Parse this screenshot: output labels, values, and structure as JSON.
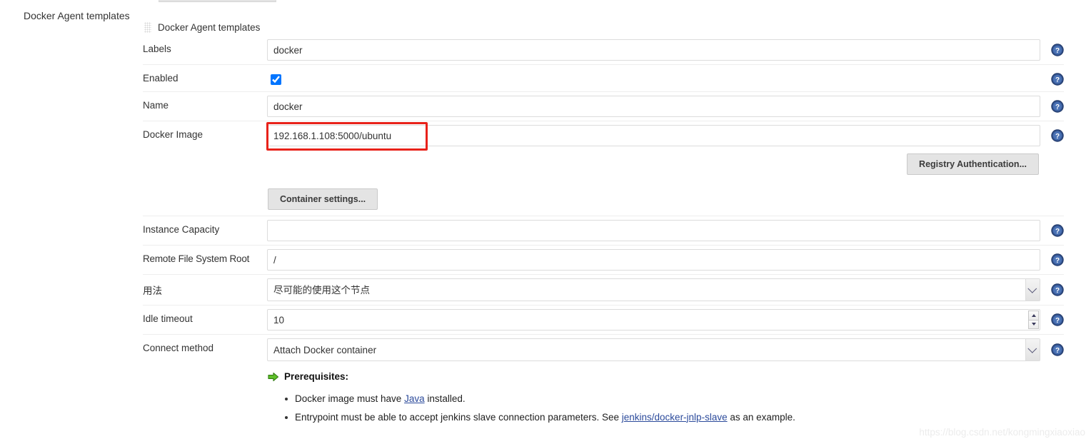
{
  "outer": {
    "section_label": "Docker Agent templates"
  },
  "template": {
    "header_title": "Docker Agent templates",
    "drag_handle_icon": "drag-grip-icon"
  },
  "fields": {
    "labels": {
      "label": "Labels",
      "value": "docker",
      "placeholder": ""
    },
    "enabled": {
      "label": "Enabled",
      "checked": true
    },
    "name": {
      "label": "Name",
      "value": "docker",
      "placeholder": ""
    },
    "docker_image": {
      "label": "Docker Image",
      "value": "192.168.1.108:5000/ubuntu",
      "placeholder": "",
      "highlight_color": "#e8221a"
    },
    "instance_capacity": {
      "label": "Instance Capacity",
      "value": "",
      "placeholder": ""
    },
    "remote_fs_root": {
      "label": "Remote File System Root",
      "value": "/",
      "placeholder": ""
    },
    "usage": {
      "label": "用法",
      "value": "尽可能的使用这个节点",
      "options": [
        "尽可能的使用这个节点"
      ]
    },
    "idle_timeout": {
      "label": "Idle timeout",
      "value": "10",
      "placeholder": ""
    },
    "connect_method": {
      "label": "Connect method",
      "value": "Attach Docker container",
      "options": [
        "Attach Docker container"
      ]
    }
  },
  "buttons": {
    "registry_authentication": "Registry Authentication...",
    "container_settings": "Container settings..."
  },
  "prerequisites": {
    "heading": "Prerequisites:",
    "arrow_icon": "green-arrow-icon",
    "items": [
      {
        "before": "Docker image must have ",
        "link": "Java",
        "after": " installed."
      },
      {
        "before": "Entrypoint must be able to accept jenkins slave connection parameters. See ",
        "link": "jenkins/docker-jnlp-slave",
        "after": " as an example."
      }
    ]
  },
  "help_icon": {
    "name": "help-icon",
    "glyph": "?",
    "color": "#33538e"
  },
  "watermark": {
    "text": "https://blog.csdn.net/kongmingxiaoxiao"
  }
}
